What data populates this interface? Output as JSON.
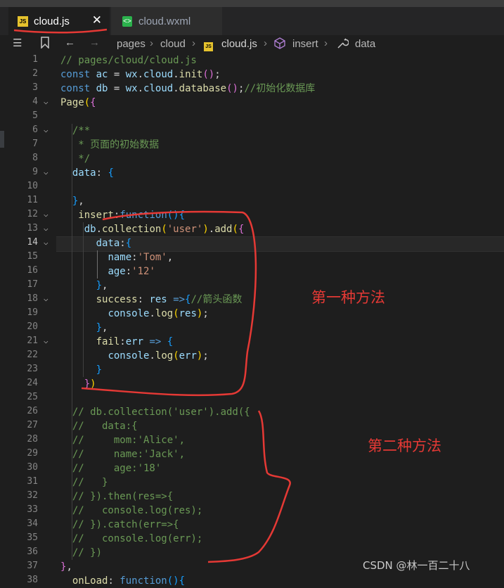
{
  "tabs": [
    {
      "label": "cloud.js",
      "icon": "js-file-icon",
      "active": true
    },
    {
      "label": "cloud.wxml",
      "icon": "wxml-file-icon",
      "active": false
    }
  ],
  "close_glyph": "✕",
  "breadcrumb": [
    "pages",
    "cloud",
    "cloud.js",
    "insert",
    "data"
  ],
  "gutter": [
    "1",
    "2",
    "3",
    "4",
    "5",
    "6",
    "7",
    "8",
    "9",
    "10",
    "11",
    "12",
    "13",
    "14",
    "15",
    "16",
    "17",
    "18",
    "19",
    "20",
    "21",
    "22",
    "23",
    "24",
    "25",
    "26",
    "27",
    "28",
    "29",
    "30",
    "31",
    "32",
    "33",
    "34",
    "35",
    "36",
    "37",
    "38"
  ],
  "code": [
    "// pages/cloud/cloud.js",
    "const ac = wx.cloud.init();",
    "const db = wx.cloud.database();//初始化数据库",
    "Page({",
    "",
    "  /**",
    "   * 页面的初始数据",
    "   */",
    "  data: {",
    "",
    "  },",
    "   insert:function(){",
    "    db.collection('user').add({",
    "      data:{",
    "        name:'Tom',",
    "        age:'12'",
    "      },",
    "      success: res =>{//箭头函数",
    "        console.log(res);",
    "      },",
    "      fail:err => {",
    "        console.log(err);",
    "      }",
    "    })",
    "",
    "  // db.collection('user').add({",
    "  //   data:{",
    "  //     mom:'Alice',",
    "  //     name:'Jack',",
    "  //     age:'18'",
    "  //   }",
    "  // }).then(res=>{",
    "  //   console.log(res);",
    "  // }).catch(err=>{",
    "  //   console.log(err);",
    "  // })",
    "},",
    "  onLoad: function(){"
  ],
  "annotations": {
    "method1": "第一种方法",
    "method2": "第二种方法"
  },
  "watermark": "CSDN @林一百二十八",
  "colors": {
    "annotation": "#e53935",
    "keyword": "#569cd6",
    "string": "#ce9178",
    "comment": "#6a9955",
    "function": "#dcdcaa"
  }
}
